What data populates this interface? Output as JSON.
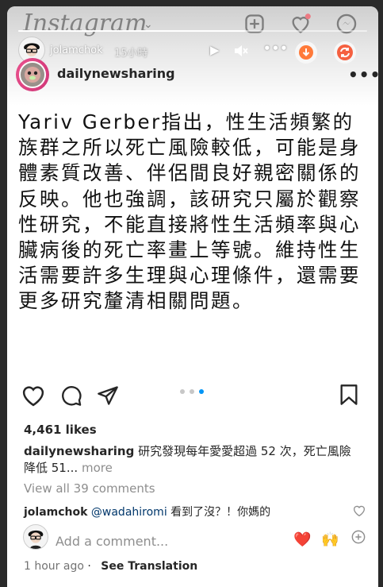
{
  "app": {
    "brand": "Instagram"
  },
  "story": {
    "progress_fraction": 0.65,
    "username": "jolamchok",
    "time_ago": "15小時"
  },
  "post": {
    "author": "dailynewsharing",
    "text": "Yariv Gerber指出，性生活頻繁的族群之所以死亡風險較低，可能是身體素質改善、伴侶間良好親密關係的反映。他也強調，該研究只屬於觀察性研究，不能直接將性生活頻率與心臟病後的死亡率畫上等號。維持性生活需要許多生理與心理條件，還需要更多研究釐清相關問題。",
    "carousel": {
      "count": 3,
      "active_index": 2
    },
    "likes": "4,461 likes",
    "caption_author": "dailynewsharing",
    "caption_text": "研究發現每年愛愛超過 52 次，死亡風險降低 51...",
    "caption_more": "more",
    "view_comments": "View all 39 comments",
    "comment": {
      "user": "jolamchok",
      "mention": "@wadahiromi",
      "text": "看到了沒？！你媽的"
    },
    "add_comment_placeholder": "Add a comment...",
    "quick_emojis": [
      "❤️",
      "🙌"
    ],
    "time": "1 hour ago",
    "see_translation": "See Translation"
  },
  "colors": {
    "accent_blue": "#0095f6",
    "story_ring": "#ff2d7a",
    "save_gradient": "#f56040"
  },
  "icons": [
    "add-post-icon",
    "heart-icon",
    "messenger-icon",
    "play-icon",
    "mute-icon",
    "more-icon",
    "download-icon",
    "repost-icon",
    "like-icon",
    "comment-icon",
    "share-icon",
    "bookmark-icon",
    "add-icon"
  ]
}
